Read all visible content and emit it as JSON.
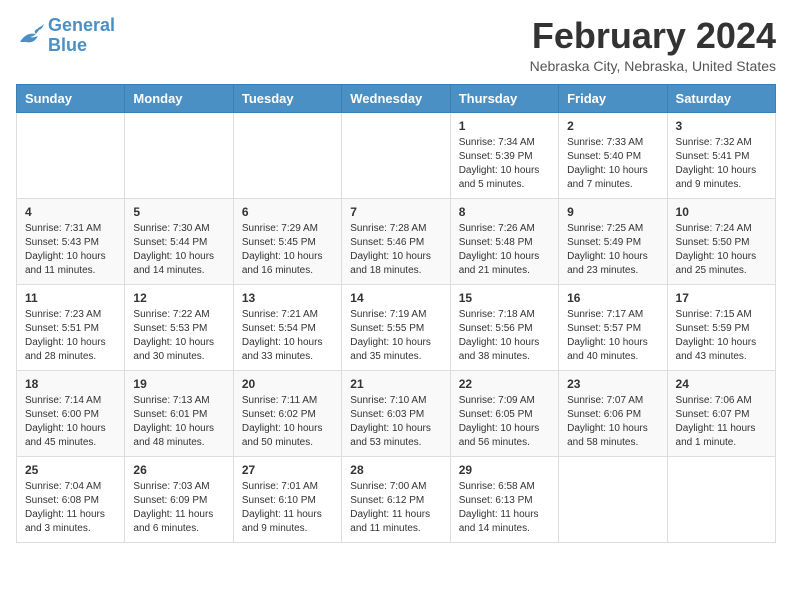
{
  "header": {
    "logo_line1": "General",
    "logo_line2": "Blue",
    "month": "February 2024",
    "location": "Nebraska City, Nebraska, United States"
  },
  "weekdays": [
    "Sunday",
    "Monday",
    "Tuesday",
    "Wednesday",
    "Thursday",
    "Friday",
    "Saturday"
  ],
  "weeks": [
    [
      {
        "day": "",
        "info": ""
      },
      {
        "day": "",
        "info": ""
      },
      {
        "day": "",
        "info": ""
      },
      {
        "day": "",
        "info": ""
      },
      {
        "day": "1",
        "info": "Sunrise: 7:34 AM\nSunset: 5:39 PM\nDaylight: 10 hours\nand 5 minutes."
      },
      {
        "day": "2",
        "info": "Sunrise: 7:33 AM\nSunset: 5:40 PM\nDaylight: 10 hours\nand 7 minutes."
      },
      {
        "day": "3",
        "info": "Sunrise: 7:32 AM\nSunset: 5:41 PM\nDaylight: 10 hours\nand 9 minutes."
      }
    ],
    [
      {
        "day": "4",
        "info": "Sunrise: 7:31 AM\nSunset: 5:43 PM\nDaylight: 10 hours\nand 11 minutes."
      },
      {
        "day": "5",
        "info": "Sunrise: 7:30 AM\nSunset: 5:44 PM\nDaylight: 10 hours\nand 14 minutes."
      },
      {
        "day": "6",
        "info": "Sunrise: 7:29 AM\nSunset: 5:45 PM\nDaylight: 10 hours\nand 16 minutes."
      },
      {
        "day": "7",
        "info": "Sunrise: 7:28 AM\nSunset: 5:46 PM\nDaylight: 10 hours\nand 18 minutes."
      },
      {
        "day": "8",
        "info": "Sunrise: 7:26 AM\nSunset: 5:48 PM\nDaylight: 10 hours\nand 21 minutes."
      },
      {
        "day": "9",
        "info": "Sunrise: 7:25 AM\nSunset: 5:49 PM\nDaylight: 10 hours\nand 23 minutes."
      },
      {
        "day": "10",
        "info": "Sunrise: 7:24 AM\nSunset: 5:50 PM\nDaylight: 10 hours\nand 25 minutes."
      }
    ],
    [
      {
        "day": "11",
        "info": "Sunrise: 7:23 AM\nSunset: 5:51 PM\nDaylight: 10 hours\nand 28 minutes."
      },
      {
        "day": "12",
        "info": "Sunrise: 7:22 AM\nSunset: 5:53 PM\nDaylight: 10 hours\nand 30 minutes."
      },
      {
        "day": "13",
        "info": "Sunrise: 7:21 AM\nSunset: 5:54 PM\nDaylight: 10 hours\nand 33 minutes."
      },
      {
        "day": "14",
        "info": "Sunrise: 7:19 AM\nSunset: 5:55 PM\nDaylight: 10 hours\nand 35 minutes."
      },
      {
        "day": "15",
        "info": "Sunrise: 7:18 AM\nSunset: 5:56 PM\nDaylight: 10 hours\nand 38 minutes."
      },
      {
        "day": "16",
        "info": "Sunrise: 7:17 AM\nSunset: 5:57 PM\nDaylight: 10 hours\nand 40 minutes."
      },
      {
        "day": "17",
        "info": "Sunrise: 7:15 AM\nSunset: 5:59 PM\nDaylight: 10 hours\nand 43 minutes."
      }
    ],
    [
      {
        "day": "18",
        "info": "Sunrise: 7:14 AM\nSunset: 6:00 PM\nDaylight: 10 hours\nand 45 minutes."
      },
      {
        "day": "19",
        "info": "Sunrise: 7:13 AM\nSunset: 6:01 PM\nDaylight: 10 hours\nand 48 minutes."
      },
      {
        "day": "20",
        "info": "Sunrise: 7:11 AM\nSunset: 6:02 PM\nDaylight: 10 hours\nand 50 minutes."
      },
      {
        "day": "21",
        "info": "Sunrise: 7:10 AM\nSunset: 6:03 PM\nDaylight: 10 hours\nand 53 minutes."
      },
      {
        "day": "22",
        "info": "Sunrise: 7:09 AM\nSunset: 6:05 PM\nDaylight: 10 hours\nand 56 minutes."
      },
      {
        "day": "23",
        "info": "Sunrise: 7:07 AM\nSunset: 6:06 PM\nDaylight: 10 hours\nand 58 minutes."
      },
      {
        "day": "24",
        "info": "Sunrise: 7:06 AM\nSunset: 6:07 PM\nDaylight: 11 hours\nand 1 minute."
      }
    ],
    [
      {
        "day": "25",
        "info": "Sunrise: 7:04 AM\nSunset: 6:08 PM\nDaylight: 11 hours\nand 3 minutes."
      },
      {
        "day": "26",
        "info": "Sunrise: 7:03 AM\nSunset: 6:09 PM\nDaylight: 11 hours\nand 6 minutes."
      },
      {
        "day": "27",
        "info": "Sunrise: 7:01 AM\nSunset: 6:10 PM\nDaylight: 11 hours\nand 9 minutes."
      },
      {
        "day": "28",
        "info": "Sunrise: 7:00 AM\nSunset: 6:12 PM\nDaylight: 11 hours\nand 11 minutes."
      },
      {
        "day": "29",
        "info": "Sunrise: 6:58 AM\nSunset: 6:13 PM\nDaylight: 11 hours\nand 14 minutes."
      },
      {
        "day": "",
        "info": ""
      },
      {
        "day": "",
        "info": ""
      }
    ]
  ]
}
